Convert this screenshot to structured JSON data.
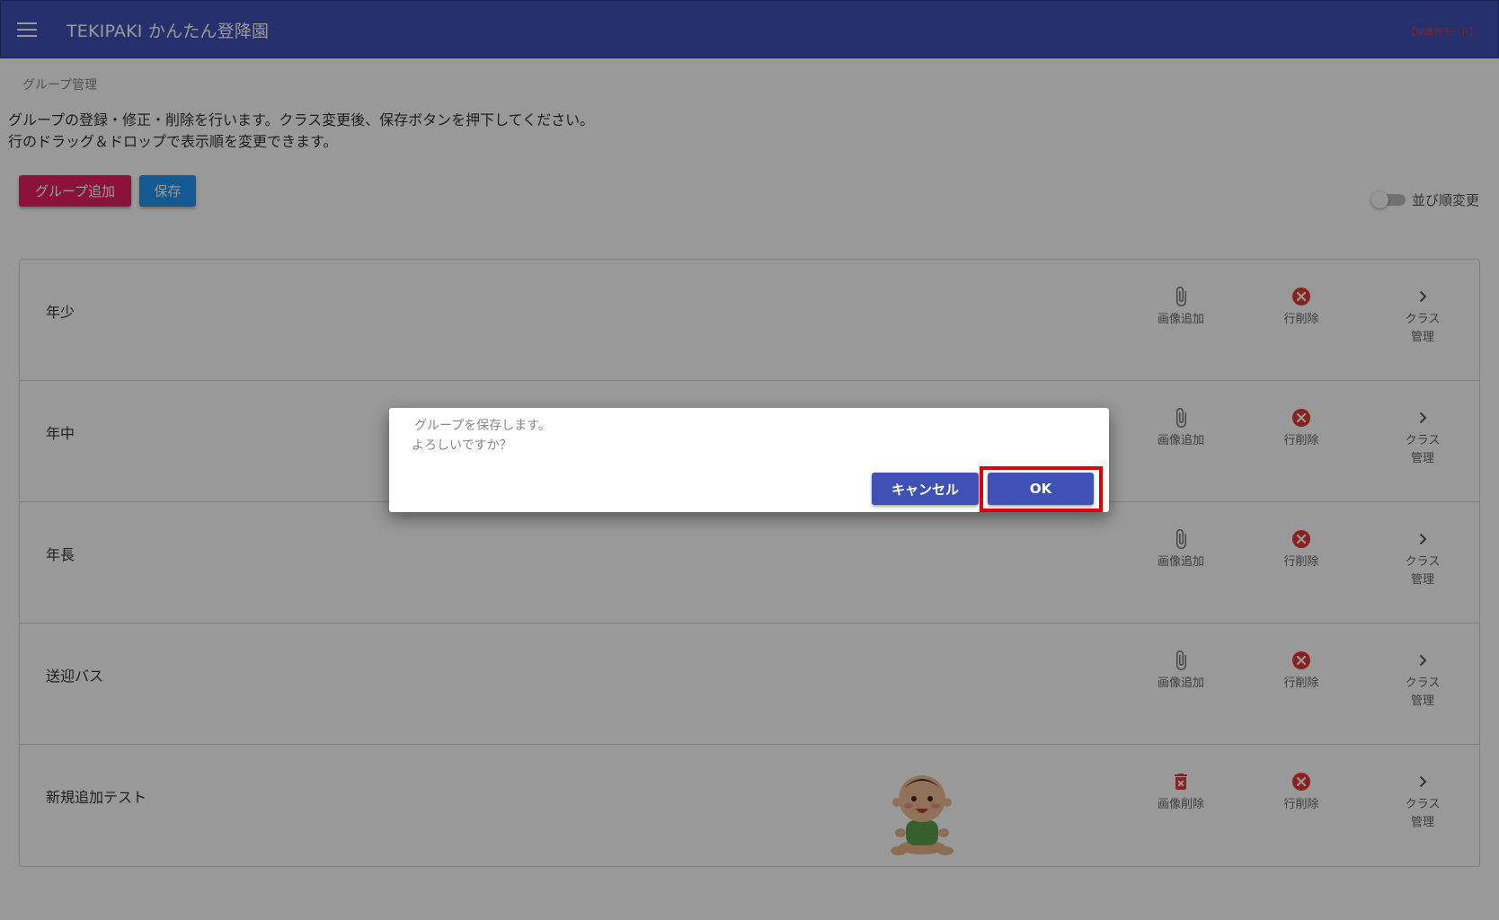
{
  "appbar": {
    "title": "TEKIPAKI かんたん登降園",
    "user_link": "【保護者モード】",
    "color": "#3f51b5"
  },
  "breadcrumb": "グループ管理",
  "description": {
    "line1": "グループの登録・修正・削除を行います。クラス変更後、保存ボタンを押下してください。",
    "line2": "行のドラッグ＆ドロップで表示順を変更できます。"
  },
  "toolbar": {
    "add_label": "グループ追加",
    "save_label": "保存",
    "add_color": "#e91e63",
    "save_color": "#2196f3",
    "sort_toggle_label": "並び順変更",
    "sort_toggle_on": false
  },
  "rows": [
    {
      "name": "年少",
      "image_action": "画像追加",
      "image_icon": "paperclip-icon",
      "delete_label": "行削除",
      "class_label_1": "クラス",
      "class_label_2": "管理"
    },
    {
      "name": "年中",
      "image_action": "画像追加",
      "image_icon": "paperclip-icon",
      "delete_label": "行削除",
      "class_label_1": "クラス",
      "class_label_2": "管理"
    },
    {
      "name": "年長",
      "image_action": "画像追加",
      "image_icon": "paperclip-icon",
      "delete_label": "行削除",
      "class_label_1": "クラス",
      "class_label_2": "管理"
    },
    {
      "name": "送迎バス",
      "image_action": "画像追加",
      "image_icon": "paperclip-icon",
      "delete_label": "行削除",
      "class_label_1": "クラス",
      "class_label_2": "管理"
    },
    {
      "name": "新規追加テスト",
      "image_action": "画像削除",
      "image_icon": "trash-icon",
      "delete_label": "行削除",
      "class_label_1": "クラス",
      "class_label_2": "管理",
      "has_image": true
    }
  ],
  "dialog": {
    "message_line1": "グループを保存します。",
    "message_line2": "よろしいですか？",
    "cancel_label": "キャンセル",
    "ok_label": "OK",
    "button_color": "#3f51b5",
    "highlight_color": "#e00000"
  }
}
